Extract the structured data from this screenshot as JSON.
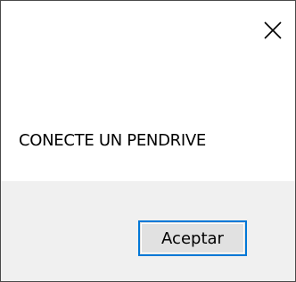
{
  "dialog": {
    "message": "CONECTE UN PENDRIVE",
    "close_icon": "close-icon",
    "ok_label": "Aceptar"
  },
  "colors": {
    "background": "#ffffff",
    "footer_background": "#f0f0f0",
    "button_background": "#e1e1e1",
    "button_focus_border": "#0078d7",
    "border": "#4a4a4a"
  }
}
